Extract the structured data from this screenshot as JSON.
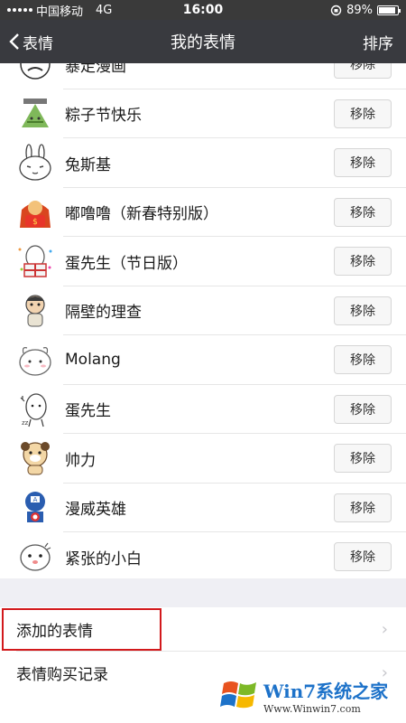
{
  "status_bar": {
    "carrier": "中国移动",
    "network": "4G",
    "time": "16:00",
    "battery": "89%",
    "battery_level": 0.89
  },
  "nav": {
    "back_label": "表情",
    "title": "我的表情",
    "sort_label": "排序"
  },
  "sticker_list": {
    "remove_label": "移除",
    "items": [
      {
        "name": "暴走漫画",
        "icon": "rage-comic-sticker-icon"
      },
      {
        "name": "粽子节快乐",
        "icon": "zongzi-sticker-icon"
      },
      {
        "name": "兔斯基",
        "icon": "tuzki-sticker-icon"
      },
      {
        "name": "嘟噜噜（新春特别版）",
        "icon": "dululu-sticker-icon"
      },
      {
        "name": "蛋先生（节日版）",
        "icon": "mr-egg-festival-sticker-icon"
      },
      {
        "name": "隔壁的理查",
        "icon": "richard-sticker-icon"
      },
      {
        "name": "Molang",
        "icon": "molang-sticker-icon"
      },
      {
        "name": "蛋先生",
        "icon": "mr-egg-sticker-icon"
      },
      {
        "name": "帅力",
        "icon": "shuaili-sticker-icon"
      },
      {
        "name": "漫威英雄",
        "icon": "marvel-sticker-icon"
      },
      {
        "name": "紧张的小白",
        "icon": "xiaobai-sticker-icon"
      }
    ]
  },
  "menu": {
    "added_stickers": "添加的表情",
    "purchase_history": "表情购买记录"
  },
  "watermark": {
    "brand": "Win7系统之家",
    "url": "Www.Winwin7.com"
  },
  "colors": {
    "nav_bg": "#393a3f",
    "status_bg": "#3a3a3a",
    "highlight_border": "#d2191c",
    "page_bg": "#efeff4"
  }
}
